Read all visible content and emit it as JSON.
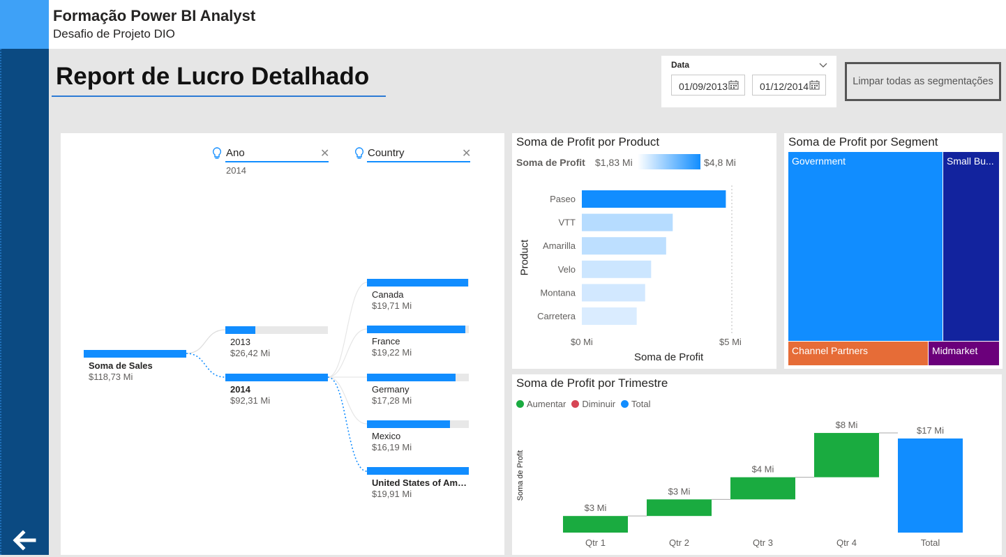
{
  "header": {
    "title": "Formação Power BI Analyst",
    "subtitle": "Desafio de Projeto DIO"
  },
  "report_title": "Report de Lucro Detalhado",
  "date_slicer": {
    "label": "Data",
    "start": "01/09/2013",
    "end": "01/12/2014"
  },
  "clear_button": "Limpar todas as segmentações",
  "decomp_tree": {
    "levels": [
      {
        "label": "Ano",
        "selected": "2014"
      },
      {
        "label": "Country"
      }
    ],
    "root": {
      "label": "Soma de Sales",
      "value": "$118,73 Mi"
    },
    "years": [
      {
        "label": "2013",
        "value": "$26,42 Mi",
        "fraction": 0.29
      },
      {
        "label": "2014",
        "value": "$92,31 Mi",
        "fraction": 1.0
      }
    ],
    "countries": [
      {
        "label": "Canada",
        "value": "$19,71 Mi",
        "fraction": 0.99
      },
      {
        "label": "France",
        "value": "$19,22 Mi",
        "fraction": 0.965
      },
      {
        "label": "Germany",
        "value": "$17,28 Mi",
        "fraction": 0.868
      },
      {
        "label": "Mexico",
        "value": "$16,19 Mi",
        "fraction": 0.813
      },
      {
        "label": "United States of Am…",
        "value": "$19,91 Mi",
        "fraction": 1.0
      }
    ]
  },
  "chart_data": [
    {
      "type": "bar",
      "title": "Soma de Profit por Product",
      "legend": {
        "label": "Soma de Profit",
        "min": "$1,83 Mi",
        "max": "$4,8 Mi"
      },
      "categories": [
        "Paseo",
        "VTT",
        "Amarilla",
        "Velo",
        "Montana",
        "Carretera"
      ],
      "values": [
        4.8,
        3.03,
        2.81,
        2.31,
        2.11,
        1.83
      ],
      "xlabel": "Soma de Profit",
      "ylabel": "Product",
      "xlim": [
        0,
        5
      ],
      "x_ticks": [
        "$0 Mi",
        "$5 Mi"
      ]
    },
    {
      "type": "treemap",
      "title": "Soma de Profit por Segment",
      "categories": [
        "Government",
        "Small Bu...",
        "Channel Partners",
        "Midmarket"
      ],
      "colors": [
        "#118dff",
        "#12239e",
        "#e66c37",
        "#6b007b"
      ]
    },
    {
      "type": "waterfall",
      "title": "Soma de Profit por Trimestre",
      "legend": [
        "Aumentar",
        "Diminuir",
        "Total"
      ],
      "legend_colors": [
        "#1aab40",
        "#d64554",
        "#118dff"
      ],
      "categories": [
        "Qtr 1",
        "Qtr 2",
        "Qtr 3",
        "Qtr 4",
        "Total"
      ],
      "values": [
        3,
        3,
        4,
        8,
        17
      ],
      "labels": [
        "$3 Mi",
        "$3 Mi",
        "$4 Mi",
        "$8 Mi",
        "$17 Mi"
      ],
      "ylabel": "Soma de Profit"
    }
  ],
  "colors": {
    "accent": "#118dff",
    "rail": "#0b4a82",
    "increase": "#1aab40"
  }
}
